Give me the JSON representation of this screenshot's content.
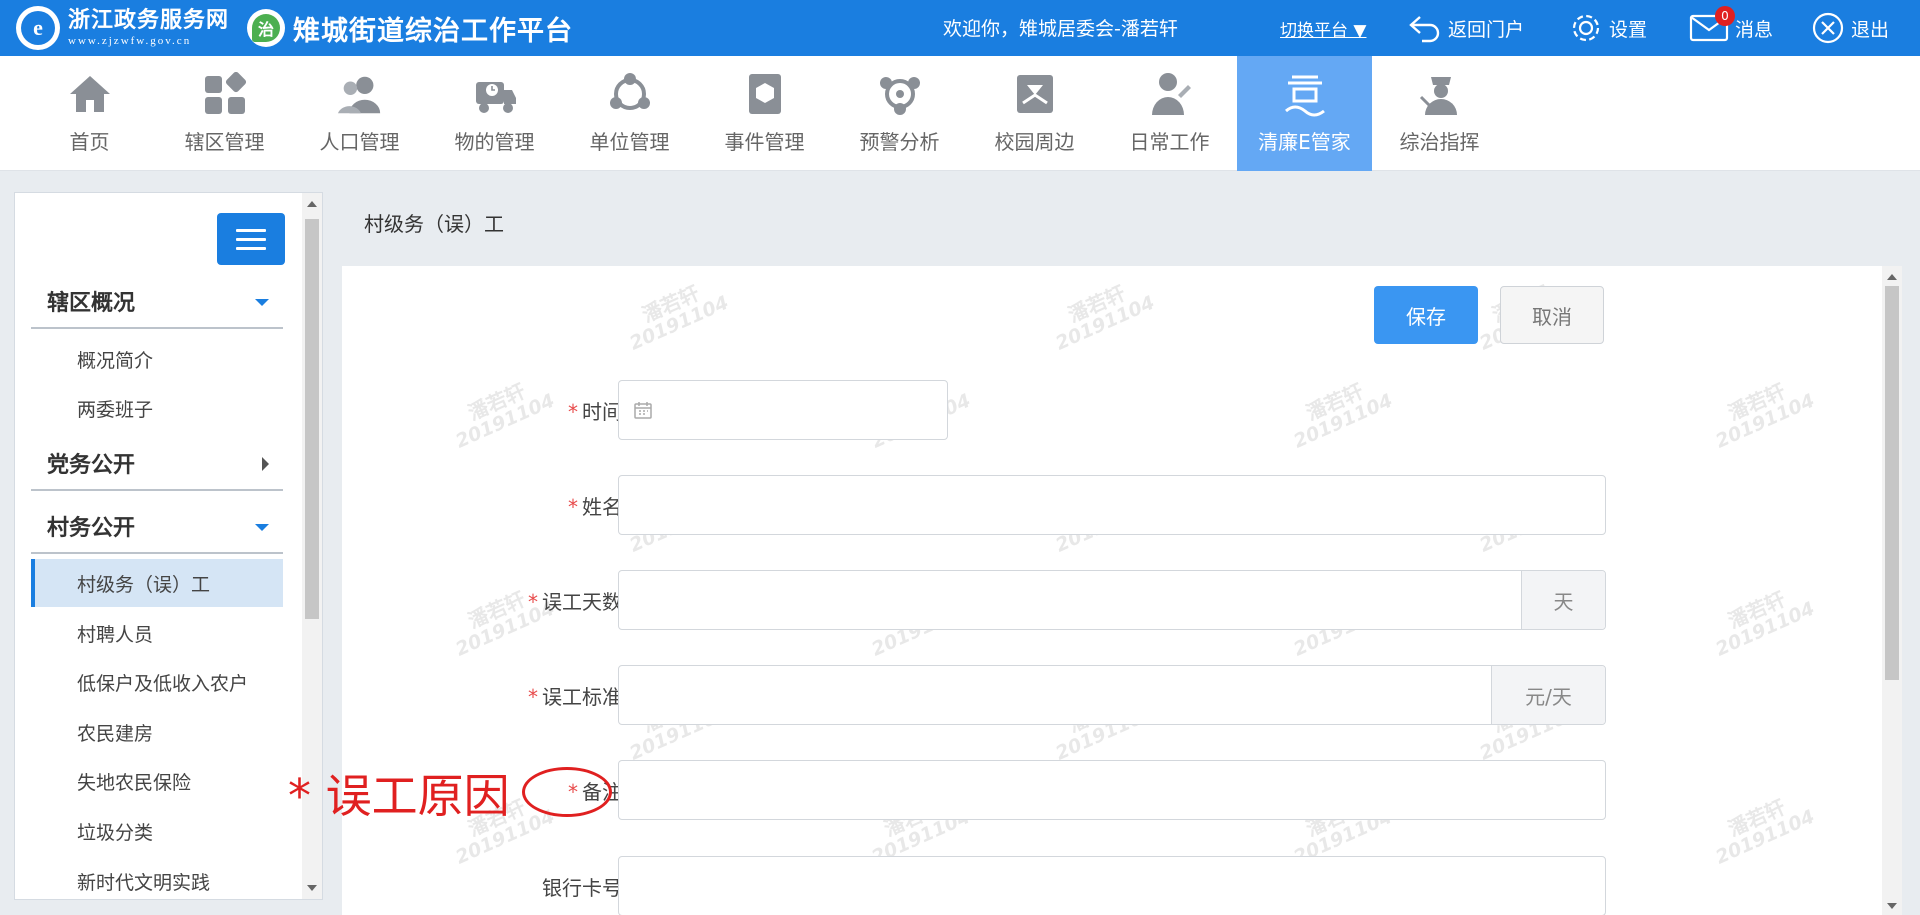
{
  "header": {
    "brand_cn": "浙江政务服务网",
    "brand_en": "www.zjzwfw.gov.cn",
    "platform_title": "雉城街道综治工作平台",
    "welcome": "欢迎你，雉城居委会-潘若轩",
    "switch_label": "切换平台 ▼",
    "return_label": "返回门户",
    "settings_label": "设置",
    "messages_label": "消息",
    "messages_count": "0",
    "logout_label": "退出"
  },
  "nav": {
    "items": [
      {
        "label": "首页",
        "icon": "home-icon"
      },
      {
        "label": "辖区管理",
        "icon": "grid-icon"
      },
      {
        "label": "人口管理",
        "icon": "people-icon"
      },
      {
        "label": "物的管理",
        "icon": "truck-icon"
      },
      {
        "label": "单位管理",
        "icon": "network-icon"
      },
      {
        "label": "事件管理",
        "icon": "book-icon"
      },
      {
        "label": "预警分析",
        "icon": "warning-network-icon"
      },
      {
        "label": "校园周边",
        "icon": "campus-icon"
      },
      {
        "label": "日常工作",
        "icon": "worker-icon"
      },
      {
        "label": "清廉E管家",
        "icon": "integrity-icon"
      },
      {
        "label": "综治指挥",
        "icon": "commander-icon"
      }
    ],
    "active_index": 9
  },
  "sidebar": {
    "groups": [
      {
        "label": "辖区概况",
        "expanded": true,
        "items": [
          "概况简介",
          "两委班子"
        ]
      },
      {
        "label": "党务公开",
        "expanded": false,
        "items": []
      },
      {
        "label": "村务公开",
        "expanded": true,
        "items": [
          "村级务（误）工",
          "村聘人员",
          "低保户及低收入农户",
          "农民建房",
          "失地农民保险",
          "垃圾分类",
          "新时代文明实践"
        ]
      }
    ],
    "active_item": "村级务（误）工"
  },
  "breadcrumb": "村级务（误）工",
  "form": {
    "save_label": "保存",
    "cancel_label": "取消",
    "required_mark": "*",
    "fields": {
      "time": {
        "label": "时间",
        "value": ""
      },
      "name": {
        "label": "姓名",
        "value": ""
      },
      "days": {
        "label": "误工天数",
        "value": "",
        "unit": "天"
      },
      "standard": {
        "label": "误工标准",
        "value": "",
        "unit": "元/天"
      },
      "remark": {
        "label": "备注",
        "value": ""
      },
      "bank_card": {
        "label": "银行卡号",
        "value": ""
      }
    }
  },
  "annotation": "* 误工原因",
  "watermark": {
    "name": "潘若轩",
    "code": "20191104"
  },
  "colors": {
    "primary": "#1a7ee0",
    "nav_active": "#64a8f4",
    "required": "#e84b4b",
    "annotation": "#e02020"
  }
}
